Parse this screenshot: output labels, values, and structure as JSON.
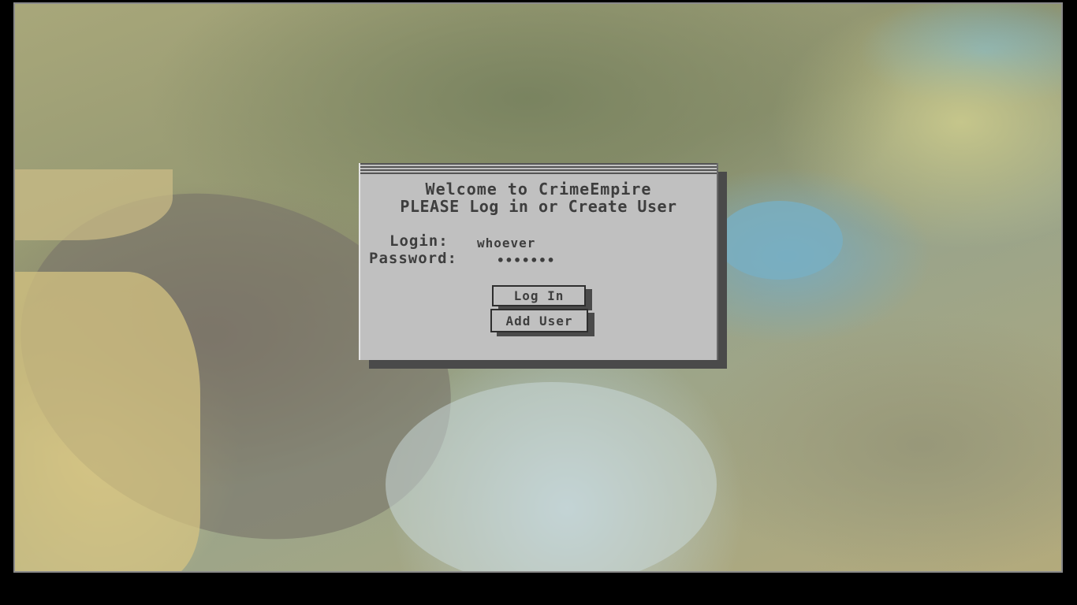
{
  "dialog": {
    "welcome": "Welcome to CrimeEmpire",
    "subtitle": "PLEASE Log in or Create User",
    "login_label": "Login:",
    "login_value": "whoever",
    "password_label": "Password:",
    "password_value": "•••••••",
    "login_button": "Log In",
    "add_user_button": "Add User"
  }
}
